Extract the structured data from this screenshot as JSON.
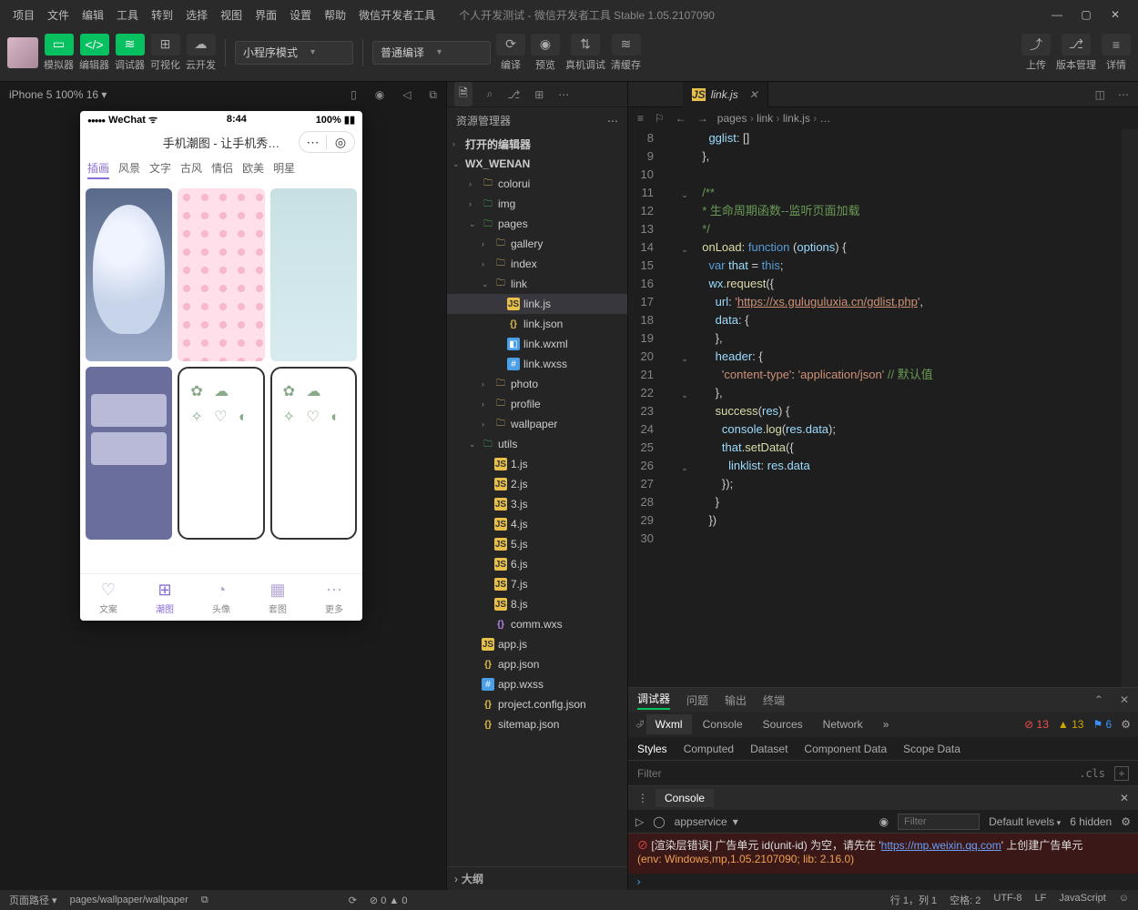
{
  "titlebar": {
    "menus": [
      "项目",
      "文件",
      "编辑",
      "工具",
      "转到",
      "选择",
      "视图",
      "界面",
      "设置",
      "帮助",
      "微信开发者工具"
    ],
    "title": "个人开发测试 - 微信开发者工具 Stable 1.05.2107090"
  },
  "toolbar": {
    "buttons": {
      "sim": "模拟器",
      "editor": "编辑器",
      "debugger": "调试器",
      "vis": "可视化",
      "cloud": "云开发"
    },
    "mode": "小程序模式",
    "compile": "普通编译",
    "actions": {
      "compile": "编译",
      "preview": "预览",
      "remote": "真机调试",
      "clear": "清缓存"
    },
    "right": {
      "upload": "上传",
      "version": "版本管理",
      "detail": "详情"
    }
  },
  "sim": {
    "device": "iPhone 5 100% 16",
    "phone": {
      "carrier": "WeChat",
      "time": "8:44",
      "battery": "100%",
      "appTitle": "手机潮图 - 让手机秀…",
      "tabs": [
        "插画",
        "风景",
        "文字",
        "古风",
        "情侣",
        "欧美",
        "明星"
      ],
      "nav": [
        {
          "l": "文案"
        },
        {
          "l": "潮图"
        },
        {
          "l": "头像"
        },
        {
          "l": "套图"
        },
        {
          "l": "更多"
        }
      ]
    }
  },
  "explorer": {
    "title": "资源管理器",
    "openEditors": "打开的编辑器",
    "project": "WX_WENAN",
    "outline": "大纲",
    "tree": [
      {
        "d": 1,
        "t": "colorui",
        "k": "fold",
        "c": "›"
      },
      {
        "d": 1,
        "t": "img",
        "k": "foldg",
        "c": "›"
      },
      {
        "d": 1,
        "t": "pages",
        "k": "foldg",
        "c": "⌄"
      },
      {
        "d": 2,
        "t": "gallery",
        "k": "fold",
        "c": "›"
      },
      {
        "d": 2,
        "t": "index",
        "k": "fold",
        "c": "›"
      },
      {
        "d": 2,
        "t": "link",
        "k": "fold",
        "c": "⌄"
      },
      {
        "d": 3,
        "t": "link.js",
        "k": "js",
        "sel": true
      },
      {
        "d": 3,
        "t": "link.json",
        "k": "json"
      },
      {
        "d": 3,
        "t": "link.wxml",
        "k": "wxml"
      },
      {
        "d": 3,
        "t": "link.wxss",
        "k": "wxss"
      },
      {
        "d": 2,
        "t": "photo",
        "k": "fold",
        "c": "›"
      },
      {
        "d": 2,
        "t": "profile",
        "k": "fold",
        "c": "›"
      },
      {
        "d": 2,
        "t": "wallpaper",
        "k": "fold",
        "c": "›"
      },
      {
        "d": 1,
        "t": "utils",
        "k": "foldg",
        "c": "⌄"
      },
      {
        "d": 2,
        "t": "1.js",
        "k": "js"
      },
      {
        "d": 2,
        "t": "2.js",
        "k": "js"
      },
      {
        "d": 2,
        "t": "3.js",
        "k": "js"
      },
      {
        "d": 2,
        "t": "4.js",
        "k": "js"
      },
      {
        "d": 2,
        "t": "5.js",
        "k": "js"
      },
      {
        "d": 2,
        "t": "6.js",
        "k": "js"
      },
      {
        "d": 2,
        "t": "7.js",
        "k": "js"
      },
      {
        "d": 2,
        "t": "8.js",
        "k": "js"
      },
      {
        "d": 2,
        "t": "comm.wxs",
        "k": "wxs"
      },
      {
        "d": 1,
        "t": "app.js",
        "k": "js"
      },
      {
        "d": 1,
        "t": "app.json",
        "k": "json"
      },
      {
        "d": 1,
        "t": "app.wxss",
        "k": "wxss"
      },
      {
        "d": 1,
        "t": "project.config.json",
        "k": "json"
      },
      {
        "d": 1,
        "t": "sitemap.json",
        "k": "json"
      }
    ]
  },
  "tab": {
    "file": "link.js"
  },
  "breadcrumb": [
    "pages",
    "link",
    "link.js",
    "…"
  ],
  "code": {
    "startLine": 8,
    "lines": [
      {
        "html": "    <span class='k-prop'>gglist</span>: []"
      },
      {
        "html": "  },"
      },
      {
        "html": ""
      },
      {
        "html": "  <span class='k-cmt'>/**</span>"
      },
      {
        "html": "<span class='k-cmt'>  * 生命周期函数--监听页面加载</span>"
      },
      {
        "html": "<span class='k-cmt'>  */</span>"
      },
      {
        "html": "  <span class='k-fn'>onLoad</span>: <span class='k-var'>function</span> (<span class='k-prop'>options</span>) {"
      },
      {
        "html": "    <span class='k-var'>var</span> <span class='k-prop'>that</span> = <span class='k-this'>this</span>;"
      },
      {
        "html": "    <span class='k-prop'>wx</span>.<span class='k-fn'>request</span>({"
      },
      {
        "html": "      <span class='k-prop'>url</span>: <span class='k-str'>'</span><span class='k-url'>https://xs.guluguluxia.cn/gdlist.php</span><span class='k-str'>'</span>,"
      },
      {
        "html": "      <span class='k-prop'>data</span>: {"
      },
      {
        "html": "      },"
      },
      {
        "html": "      <span class='k-prop'>header</span>: {"
      },
      {
        "html": "        <span class='k-str'>'content-type'</span>: <span class='k-str'>'application/json'</span> <span class='k-cmt'>// 默认值</span>"
      },
      {
        "html": "      },"
      },
      {
        "html": "      <span class='k-fn'>success</span>(<span class='k-prop'>res</span>) {"
      },
      {
        "html": "        <span class='k-prop'>console</span>.<span class='k-fn'>log</span>(<span class='k-prop'>res</span>.<span class='k-prop'>data</span>);"
      },
      {
        "html": "        <span class='k-prop'>that</span>.<span class='k-fn'>setData</span>({"
      },
      {
        "html": "          <span class='k-prop'>linklist</span>: <span class='k-prop'>res</span>.<span class='k-prop'>data</span>"
      },
      {
        "html": "        });"
      },
      {
        "html": "      }"
      },
      {
        "html": "    })"
      },
      {
        "html": ""
      }
    ],
    "folds": {
      "11": "⌄",
      "14": "⌄",
      "20": "⌄",
      "22": "⌄",
      "26": "⌄"
    }
  },
  "debugger": {
    "tabs": [
      "调试器",
      "问题",
      "输出",
      "终端"
    ],
    "dev": [
      "Wxml",
      "Console",
      "Sources",
      "Network"
    ],
    "devMore": "»",
    "counts": {
      "err": "13",
      "wrn": "13",
      "inf": "6"
    },
    "styles": [
      "Styles",
      "Computed",
      "Dataset",
      "Component Data",
      "Scope Data"
    ],
    "filter": "Filter",
    "cls": ".cls",
    "console": {
      "tab": "Console",
      "context": "appservice",
      "filterPh": "Filter",
      "level": "Default levels",
      "hidden": "6 hidden",
      "msg1a": "[渲染层错误] 广告单元 id(unit-id) 为空，请先在 '",
      "msg1b": "https://mp.weixin.qq.com",
      "msg1c": "' 上创建广告单元",
      "msg2": "(env: Windows,mp,1.05.2107090; lib: 2.16.0)"
    }
  },
  "status": {
    "pathLabel": "页面路径",
    "path": "pages/wallpaper/wallpaper",
    "errs": "0",
    "wrns": "0",
    "pos": "行 1，列 1",
    "spaces": "空格: 2",
    "enc": "UTF-8",
    "eol": "LF",
    "lang": "JavaScript"
  }
}
